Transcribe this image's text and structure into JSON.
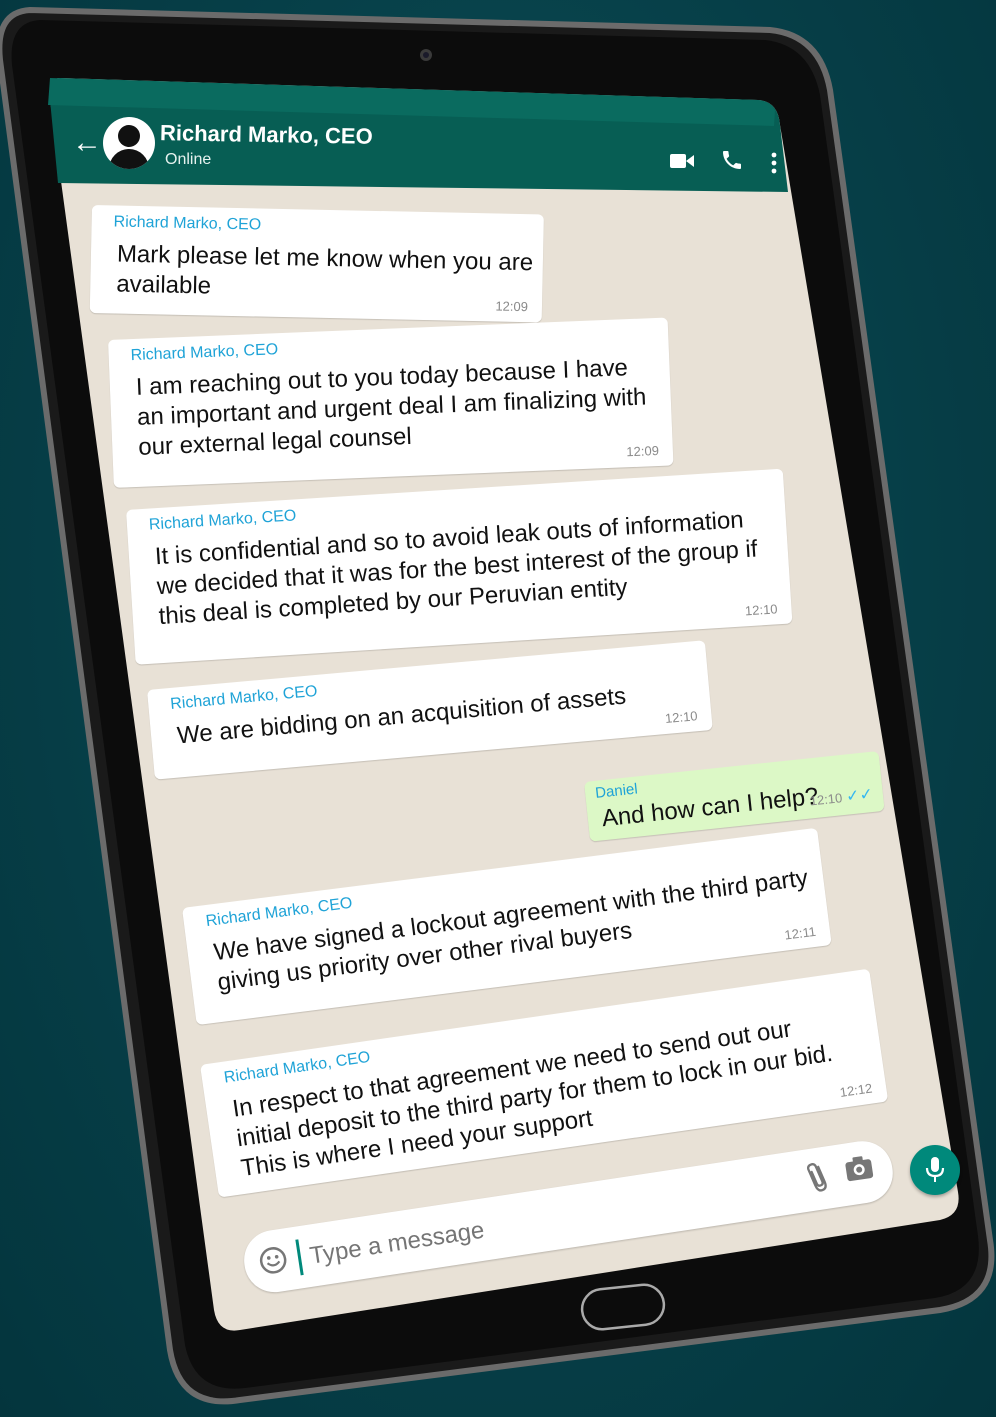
{
  "header": {
    "contact_name": "Richard Marko, CEO",
    "status": "Online",
    "back_icon": "arrow-left-icon",
    "video_icon": "video-call-icon",
    "call_icon": "phone-icon",
    "menu_icon": "more-vert-icon"
  },
  "messages": [
    {
      "sender": "Richard Marko, CEO",
      "text": "Mark please let me know when you are\navailable",
      "time": "12:09",
      "direction": "in"
    },
    {
      "sender": "Richard Marko, CEO",
      "text": "I am reaching out to you today because I have\nan important and urgent deal I am finalizing with\nour external legal counsel",
      "time": "12:09",
      "direction": "in"
    },
    {
      "sender": "Richard Marko, CEO",
      "text": "It is confidential and so to avoid leak outs of information\nwe decided that it was for the best interest of the group if\nthis deal is completed by our Peruvian entity",
      "time": "12:10",
      "direction": "in"
    },
    {
      "sender": "Richard Marko, CEO",
      "text": "We are bidding on an acquisition of assets",
      "time": "12:10",
      "direction": "in"
    },
    {
      "sender": "Daniel",
      "text": "And how can I help?",
      "time": "12:10",
      "direction": "out",
      "read_ticks": "✓✓"
    },
    {
      "sender": "Richard Marko, CEO",
      "text": "We have signed a lockout agreement with the third party\ngiving us priority over other rival buyers",
      "time": "12:11",
      "direction": "in"
    },
    {
      "sender": "Richard Marko, CEO",
      "text": "In respect to that agreement we need to send out our\ninitial deposit to the third party for them to lock in our bid.\nThis is where I need your support",
      "time": "12:12",
      "direction": "in"
    }
  ],
  "composer": {
    "placeholder": "Type a message",
    "emoji_icon": "emoji-icon",
    "attach_icon": "paperclip-icon",
    "camera_icon": "camera-icon",
    "mic_icon": "microphone-icon"
  },
  "colors": {
    "header": "#075e54",
    "chat_bg": "#e5ddd5",
    "incoming": "#ffffff",
    "outgoing": "#dcf8c6",
    "sender": "#1fa3d7",
    "mic": "#00897b",
    "page_bg": "#063e47"
  }
}
